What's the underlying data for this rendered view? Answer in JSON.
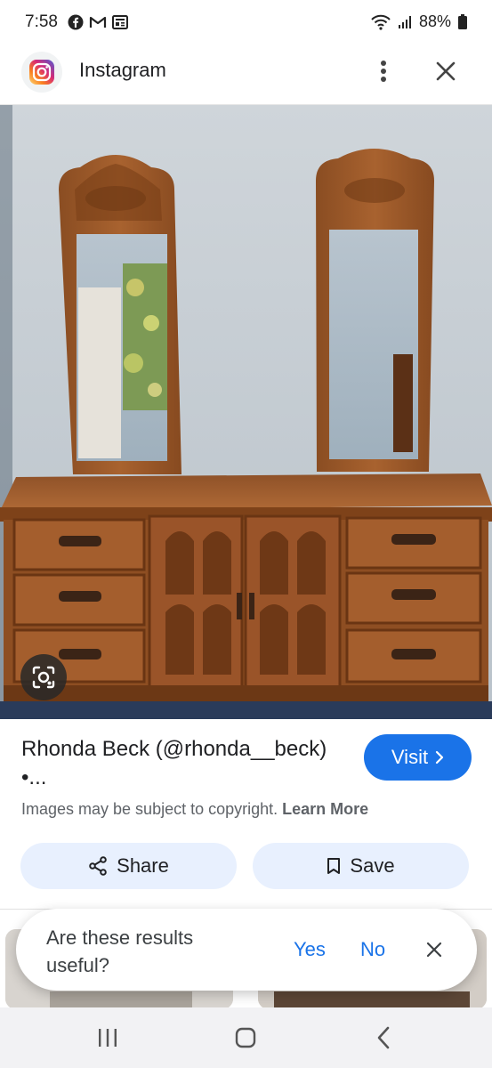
{
  "status_bar": {
    "time": "7:58",
    "battery": "88%",
    "left_icons": [
      "facebook-icon",
      "gmail-icon",
      "news-icon"
    ],
    "right_icons": [
      "wifi-icon",
      "signal-icon",
      "battery-icon"
    ]
  },
  "header": {
    "app_name": "Instagram",
    "icons": [
      "instagram-icon",
      "more-vert-icon",
      "close-icon"
    ]
  },
  "result": {
    "title": "Rhonda Beck (@rhonda__beck) •...",
    "visit_label": "Visit",
    "copyright_text": "Images may be subject to copyright.",
    "learn_more": "Learn More"
  },
  "actions": {
    "share_label": "Share",
    "save_label": "Save"
  },
  "feedback": {
    "question": "Are these results useful?",
    "yes": "Yes",
    "no": "No"
  },
  "colors": {
    "accent": "#1a73e8",
    "chip_bg": "#e8f0fe",
    "wood": "#9a5a2c",
    "wall": "#c9d0d6"
  }
}
